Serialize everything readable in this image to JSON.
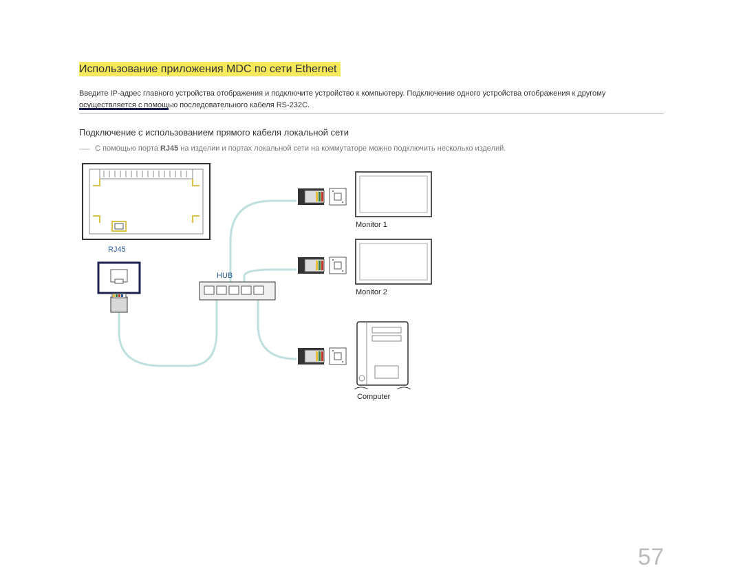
{
  "header": {
    "highlight": "Использование приложения MDC по сети Ethernet"
  },
  "intro": "Введите IP-адрес главного устройства отображения и подключите устройство к компьютеру. Подключение одного устройства отображения к другому осуществляется с помощью последовательного кабеля RS-232C.",
  "subhead": "Подключение с использованием прямого кабеля локальной сети",
  "note_dash": "―",
  "note_pre": "С помощью порта ",
  "note_bold": "RJ45",
  "note_post": " на изделии и портах локальной сети на коммутаторе можно подключить несколько изделий.",
  "labels": {
    "rj45": "RJ45",
    "hub": "HUB",
    "mon1": "Monitor 1",
    "mon2": "Monitor 2",
    "computer": "Computer"
  },
  "page": "57"
}
